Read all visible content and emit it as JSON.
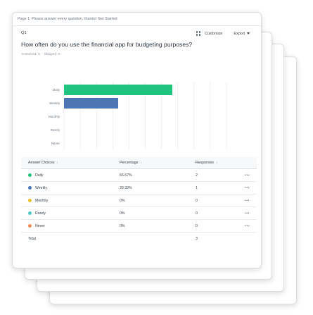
{
  "page_banner": "Page 1: Please answer every question, thanks! Get Started",
  "question": {
    "number": "Q1",
    "title": "How often do you use the financial app for budgeting purposes?",
    "answered": "Answered: 3",
    "skipped": "Skipped: 0"
  },
  "toolbar": {
    "customize_label": "Customize",
    "export_label": "Export",
    "customize_icon": "grid-settings-icon",
    "export_icon": "chevron-down-icon"
  },
  "chart_data": {
    "type": "bar",
    "orientation": "horizontal",
    "categories": [
      "Daily",
      "Weekly",
      "Monthly",
      "Rarely",
      "Never"
    ],
    "values": [
      66.67,
      33.33,
      0,
      0,
      0
    ],
    "colors": [
      "#21c47f",
      "#4f76b4",
      "#e8c02a",
      "#52cbc7",
      "#ef8d55"
    ],
    "xlim": [
      0,
      100
    ],
    "xticks": [
      "0%",
      "10%",
      "20%",
      "30%",
      "40%",
      "50%",
      "60%",
      "70%",
      "80%",
      "90%",
      "100%"
    ],
    "grid": true
  },
  "table": {
    "headers": {
      "choices": "Answer Choices",
      "percentage": "Percentage",
      "responses": "Responses"
    },
    "rows": [
      {
        "choice": "Daily",
        "percentage": "66.67%",
        "responses": "2",
        "color": "#21c47f"
      },
      {
        "choice": "Weekly",
        "percentage": "33.33%",
        "responses": "1",
        "color": "#4f76b4"
      },
      {
        "choice": "Monthly",
        "percentage": "0%",
        "responses": "0",
        "color": "#e8c02a"
      },
      {
        "choice": "Rarely",
        "percentage": "0%",
        "responses": "0",
        "color": "#52cbc7"
      },
      {
        "choice": "Never",
        "percentage": "0%",
        "responses": "0",
        "color": "#ef8d55"
      }
    ],
    "total_label": "Total",
    "total_value": "3",
    "more_glyph": "•••"
  }
}
